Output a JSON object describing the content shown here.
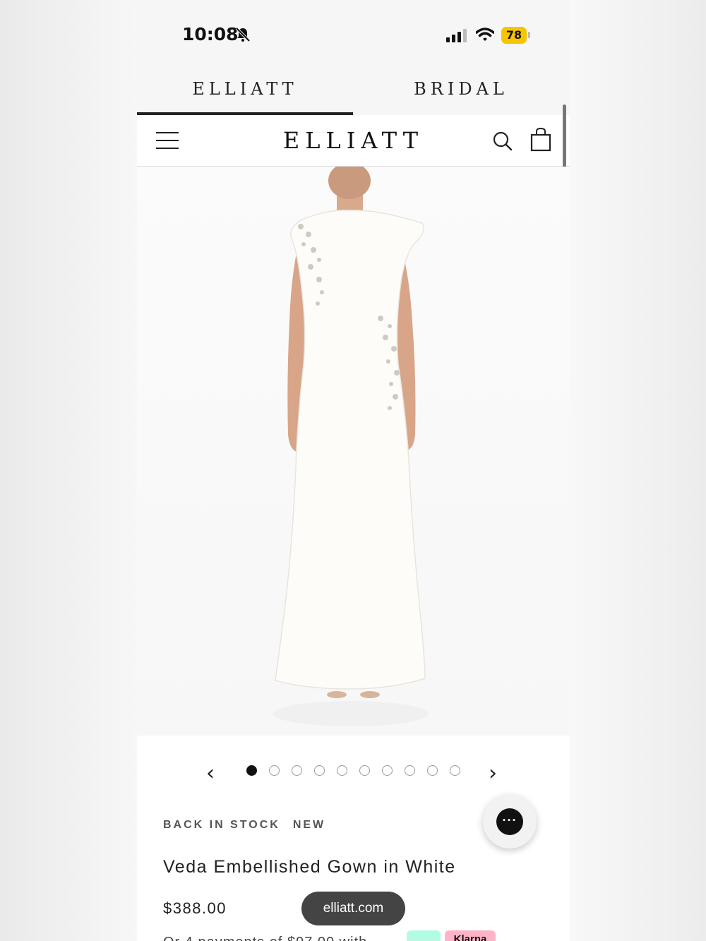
{
  "status_bar": {
    "time": "10:08",
    "battery": "78"
  },
  "brand_tabs": {
    "left": "ELLIATT",
    "right": "BRIDAL"
  },
  "header": {
    "logo": "ELLIATT"
  },
  "carousel": {
    "prev": "‹",
    "next": "›",
    "dot_count": 10,
    "active_index": 0
  },
  "product": {
    "tags": [
      "BACK IN STOCK",
      "NEW"
    ],
    "name": "Veda Embellished Gown in White",
    "price": "$388.00",
    "installment_text": "Or 4 payments of $97.00 with",
    "klarna_label": "Klarna"
  },
  "chat": {
    "label": "···"
  },
  "browser": {
    "url": "elliatt.com"
  },
  "colors": {
    "text": "#222222",
    "battery": "#f6c400",
    "afterpay": "#b2fce4",
    "klarna": "#ffb3c7"
  }
}
